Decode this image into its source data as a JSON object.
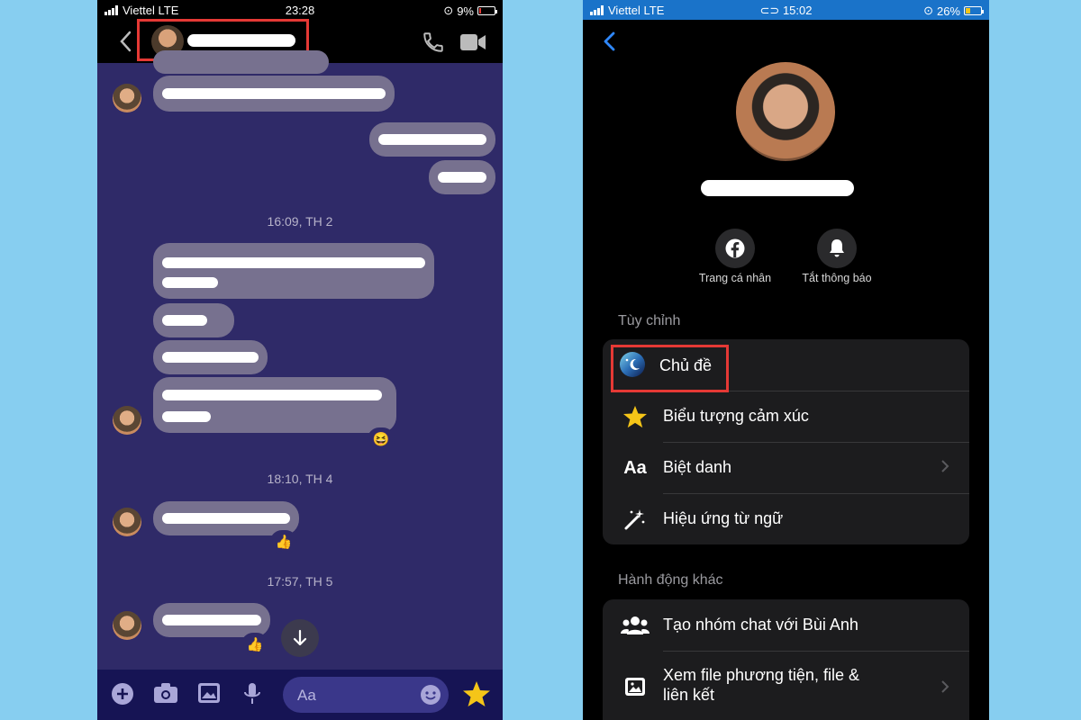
{
  "left_phone": {
    "status": {
      "carrier": "Viettel LTE",
      "time": "23:28",
      "battery": "9%",
      "battery_level": 0.09
    },
    "timestamps": [
      "16:09, TH 2",
      "18:10, TH 4",
      "17:57, TH 5"
    ],
    "reactions": [
      "😆",
      "👍",
      "👍"
    ],
    "composer": {
      "placeholder": "Aa"
    },
    "colors": {
      "chat_bg": "#2f2a68",
      "bubble": "#77718f",
      "input_bar": "#161454",
      "highlight": "#e53935"
    },
    "icons": [
      "back-icon",
      "phone-icon",
      "video-icon",
      "plus-icon",
      "camera-icon",
      "image-icon",
      "mic-icon",
      "emoji-icon",
      "star-icon",
      "arrow-down-icon"
    ]
  },
  "right_phone": {
    "status": {
      "carrier": "Viettel LTE",
      "time": "15:02",
      "battery": "26%",
      "battery_level": 0.26
    },
    "actions": {
      "profile_label": "Trang cá nhân",
      "mute_label": "Tắt thông báo"
    },
    "customize": {
      "title": "Tùy chỉnh",
      "items": [
        {
          "label": "Chủ đề",
          "icon": "theme-icon"
        },
        {
          "label": "Biểu tượng cảm xúc",
          "icon": "star-icon"
        },
        {
          "label": "Biệt danh",
          "icon": "text-aa-icon"
        },
        {
          "label": "Hiệu ứng từ ngữ",
          "icon": "magic-wand-icon"
        }
      ]
    },
    "more_actions": {
      "title": "Hành động khác",
      "items": [
        {
          "label": "Tạo nhóm chat với Bùi Anh",
          "icon": "group-icon"
        },
        {
          "label_line1": "Xem file phương tiện, file &",
          "label_line2": "liên kết",
          "icon": "media-icon"
        }
      ]
    },
    "colors": {
      "status_bar": "#1a73c9",
      "card": "#1c1c1e",
      "accent": "#2f88ff",
      "highlight": "#e53935"
    }
  }
}
